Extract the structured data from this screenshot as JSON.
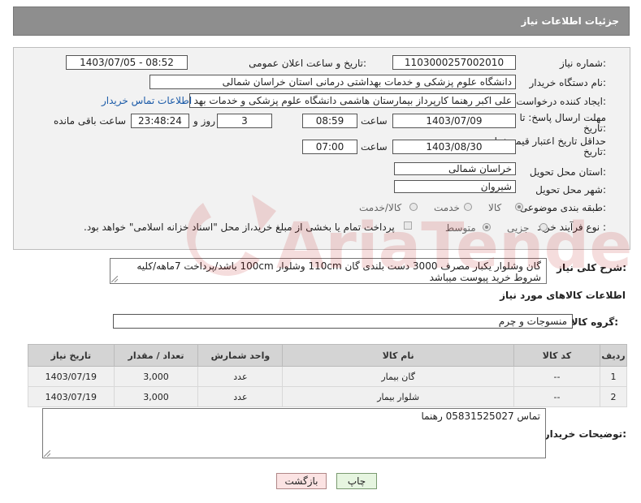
{
  "header": {
    "title": "جزئیات اطلاعات نیاز"
  },
  "form": {
    "need_number_label": "شماره نیاز:",
    "need_number": "1103000257002010",
    "announce_label": "تاریخ و ساعت اعلان عمومی:",
    "announce_value": "1403/07/05 - 08:52",
    "buyer_org_label": "نام دستگاه خریدار:",
    "buyer_org": "دانشگاه علوم پزشکی و خدمات بهداشتی درمانی استان خراسان شمالی",
    "creator_label": "ایجاد کننده درخواست:",
    "creator": "علی اکبر رهنما کارپرداز بیمارستان هاشمی دانشگاه علوم پزشکی و خدمات بهد",
    "contact_link": "اطلاعات تماس خریدار",
    "deadline_label_1": "مهلت ارسال پاسخ: تا",
    "deadline_label_2": "تاریخ:",
    "deadline_date": "1403/07/09",
    "time_label": "ساعت",
    "deadline_time": "08:59",
    "days": "3",
    "days_label": "روز و",
    "remaining_time": "23:48:24",
    "remaining_label": "ساعت باقی مانده",
    "validity_label_1": "حداقل تاریخ اعتبار قیمت: تا",
    "validity_label_2": "تاریخ:",
    "validity_date": "1403/08/30",
    "validity_time_label": "ساعت",
    "validity_time": "07:00",
    "province_label": "استان محل تحویل:",
    "province": "خراسان شمالی",
    "city_label": "شهر محل تحویل:",
    "city": "شیروان",
    "category_label": "طبقه بندی موضوعی:",
    "category_options": [
      "کالا",
      "خدمت",
      "کالا/خدمت"
    ],
    "process_label": "نوع فرآیند خرید :",
    "process_options": [
      "جزیی",
      "متوسط"
    ],
    "payment_note": "پرداخت تمام یا بخشی از مبلغ خرید،از محل \"اسناد خزانه اسلامی\" خواهد بود."
  },
  "description": {
    "label": "شرح کلی نیاز:",
    "text": "گان وشلوار یکبار مصرف 3000 دست بلندی گان 110cm وشلوار 100cm باشد/پرداخت 7ماهه/کلیه شروط خرید پیوست میباشد"
  },
  "goods": {
    "section_title": "اطلاعات کالاهای مورد نیاز",
    "group_label": "گروه کالا:",
    "group_value": "منسوجات و چرم",
    "columns": [
      "ردیف",
      "کد کالا",
      "نام کالا",
      "واحد شمارش",
      "تعداد / مقدار",
      "تاریخ نیاز"
    ],
    "rows": [
      {
        "idx": "1",
        "code": "--",
        "name": "گان بیمار",
        "unit": "عدد",
        "qty": "3,000",
        "date": "1403/07/19"
      },
      {
        "idx": "2",
        "code": "--",
        "name": "شلوار بیمار",
        "unit": "عدد",
        "qty": "3,000",
        "date": "1403/07/19"
      }
    ]
  },
  "notes": {
    "label": "توضیحات خریدار:",
    "text": "تماس 05831525027 رهنما"
  },
  "buttons": {
    "print": "چاپ",
    "back": "بازگشت"
  },
  "watermark": {
    "text": "AriaTender.net"
  }
}
